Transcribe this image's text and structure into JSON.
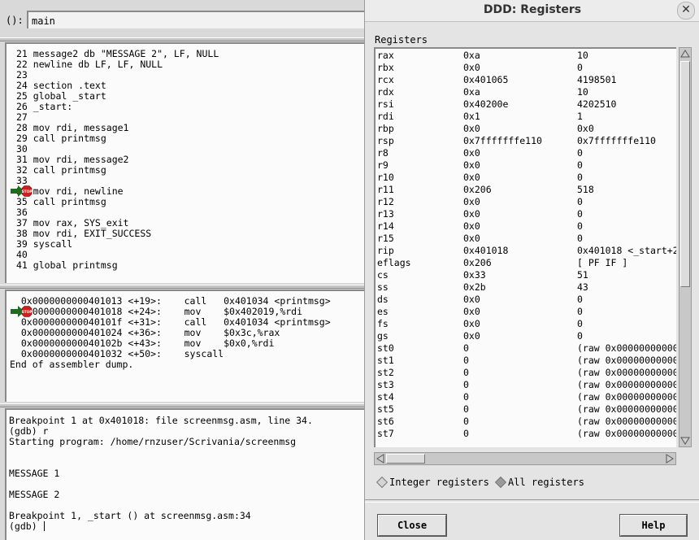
{
  "main_window": {
    "arg_label": "():",
    "arg_value": "main",
    "source_lines": [
      "21 message2 db \"MESSAGE 2\", LF, NULL",
      "22 newline db LF, LF, NULL",
      "23",
      "24 section .text",
      "25 global _start",
      "26 _start:",
      "27",
      "28 mov rdi, message1",
      "29 call printmsg",
      "30",
      "31 mov rdi, message2",
      "32 call printmsg",
      "33",
      "34 mov rdi, newline",
      "35 call printmsg",
      "36",
      "37 mov rax, SYS_exit",
      "38 mov rdi, EXIT_SUCCESS",
      "39 syscall",
      "40",
      "41 global printmsg"
    ],
    "asm_lines": [
      "  0x0000000000401013 <+19>:    call   0x401034 <printmsg>",
      "  0x0000000000401018 <+24>:    mov    $0x402019,%rdi",
      "  0x000000000040101f <+31>:    call   0x401034 <printmsg>",
      "  0x0000000000401024 <+36>:    mov    $0x3c,%rax",
      "  0x000000000040102b <+43>:    mov    $0x0,%rdi",
      "  0x0000000000401032 <+50>:    syscall",
      "End of assembler dump."
    ],
    "console_lines": [
      "Breakpoint 1 at 0x401018: file screenmsg.asm, line 34.",
      "(gdb) r",
      "Starting program: /home/rnzuser/Scrivania/screenmsg",
      "",
      "",
      "MESSAGE 1",
      "",
      "MESSAGE 2",
      "",
      "Breakpoint 1, _start () at screenmsg.asm:34",
      "(gdb) "
    ],
    "stop_label": "STOP"
  },
  "registers_window": {
    "title": "DDD: Registers",
    "section_label": "Registers",
    "rows": [
      {
        "name": "rax",
        "hex": "0xa",
        "natural": "10"
      },
      {
        "name": "rbx",
        "hex": "0x0",
        "natural": "0"
      },
      {
        "name": "rcx",
        "hex": "0x401065",
        "natural": "4198501"
      },
      {
        "name": "rdx",
        "hex": "0xa",
        "natural": "10"
      },
      {
        "name": "rsi",
        "hex": "0x40200e",
        "natural": "4202510"
      },
      {
        "name": "rdi",
        "hex": "0x1",
        "natural": "1"
      },
      {
        "name": "rbp",
        "hex": "0x0",
        "natural": "0x0"
      },
      {
        "name": "rsp",
        "hex": "0x7fffffffe110",
        "natural": "0x7fffffffe110"
      },
      {
        "name": "r8",
        "hex": "0x0",
        "natural": "0"
      },
      {
        "name": "r9",
        "hex": "0x0",
        "natural": "0"
      },
      {
        "name": "r10",
        "hex": "0x0",
        "natural": "0"
      },
      {
        "name": "r11",
        "hex": "0x206",
        "natural": "518"
      },
      {
        "name": "r12",
        "hex": "0x0",
        "natural": "0"
      },
      {
        "name": "r13",
        "hex": "0x0",
        "natural": "0"
      },
      {
        "name": "r14",
        "hex": "0x0",
        "natural": "0"
      },
      {
        "name": "r15",
        "hex": "0x0",
        "natural": "0"
      },
      {
        "name": "rip",
        "hex": "0x401018",
        "natural": "0x401018 <_start+2"
      },
      {
        "name": "eflags",
        "hex": "0x206",
        "natural": "[ PF IF ]"
      },
      {
        "name": "cs",
        "hex": "0x33",
        "natural": "51"
      },
      {
        "name": "ss",
        "hex": "0x2b",
        "natural": "43"
      },
      {
        "name": "ds",
        "hex": "0x0",
        "natural": "0"
      },
      {
        "name": "es",
        "hex": "0x0",
        "natural": "0"
      },
      {
        "name": "fs",
        "hex": "0x0",
        "natural": "0"
      },
      {
        "name": "gs",
        "hex": "0x0",
        "natural": "0"
      },
      {
        "name": "st0",
        "hex": "0",
        "natural": "(raw 0x000000000000"
      },
      {
        "name": "st1",
        "hex": "0",
        "natural": "(raw 0x000000000000"
      },
      {
        "name": "st2",
        "hex": "0",
        "natural": "(raw 0x000000000000"
      },
      {
        "name": "st3",
        "hex": "0",
        "natural": "(raw 0x000000000000"
      },
      {
        "name": "st4",
        "hex": "0",
        "natural": "(raw 0x000000000000"
      },
      {
        "name": "st5",
        "hex": "0",
        "natural": "(raw 0x000000000000"
      },
      {
        "name": "st6",
        "hex": "0",
        "natural": "(raw 0x000000000000"
      },
      {
        "name": "st7",
        "hex": "0",
        "natural": "(raw 0x000000000000"
      }
    ],
    "radio_integer": "Integer registers",
    "radio_all": "All registers",
    "selected_radio": "all",
    "close_button": "Close",
    "help_button": "Help",
    "close_x": "✕"
  },
  "colors": {
    "stop_sign": "#cc1f1f",
    "pc_arrow": "#1f6b1f"
  }
}
